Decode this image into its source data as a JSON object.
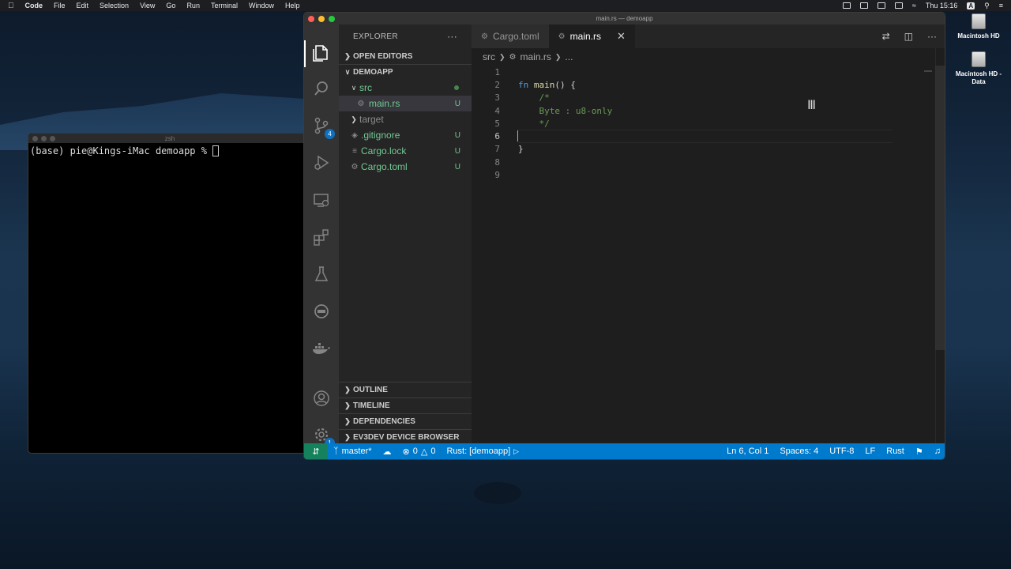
{
  "menubar": {
    "app": "Code",
    "items": [
      "File",
      "Edit",
      "Selection",
      "View",
      "Go",
      "Run",
      "Terminal",
      "Window",
      "Help"
    ],
    "clock": "Thu 15:16",
    "input_source": "A"
  },
  "desktop": {
    "disk1": "Macintosh HD",
    "disk2": "Macintosh HD - Data"
  },
  "terminal": {
    "title": "zsh",
    "prompt": "(base) pie@Kings-iMac demoapp % "
  },
  "window": {
    "title": "main.rs — demoapp"
  },
  "activity": {
    "scm_badge": "4",
    "settings_badge": "1"
  },
  "explorer": {
    "header": "EXPLORER",
    "open_editors": "OPEN EDITORS",
    "project": "DEMOAPP",
    "tree": [
      {
        "label": "src",
        "status": ""
      },
      {
        "label": "main.rs",
        "status": "U"
      },
      {
        "label": "target",
        "status": ""
      },
      {
        "label": ".gitignore",
        "status": "U"
      },
      {
        "label": "Cargo.lock",
        "status": "U"
      },
      {
        "label": "Cargo.toml",
        "status": "U"
      }
    ],
    "sections": [
      "OUTLINE",
      "TIMELINE",
      "DEPENDENCIES",
      "EV3DEV DEVICE BROWSER"
    ]
  },
  "tabs": [
    {
      "label": "Cargo.toml"
    },
    {
      "label": "main.rs"
    }
  ],
  "breadcrumb": {
    "folder": "src",
    "file": "main.rs",
    "more": "..."
  },
  "code": {
    "line_numbers": [
      "1",
      "2",
      "3",
      "4",
      "5",
      "6",
      "7",
      "8",
      "9"
    ],
    "fn_kw": "fn",
    "fn_name": "main",
    "fn_rest": "() {",
    "comment_open": "    /*",
    "comment_body": "    Byte : u8-only",
    "comment_close": "    */",
    "close_brace": "}"
  },
  "status": {
    "branch": "master*",
    "errors": "0",
    "warnings": "0",
    "rust": "Rust: [demoapp]",
    "position": "Ln 6, Col 1",
    "spaces": "Spaces: 4",
    "encoding": "UTF-8",
    "eol": "LF",
    "language": "Rust"
  }
}
